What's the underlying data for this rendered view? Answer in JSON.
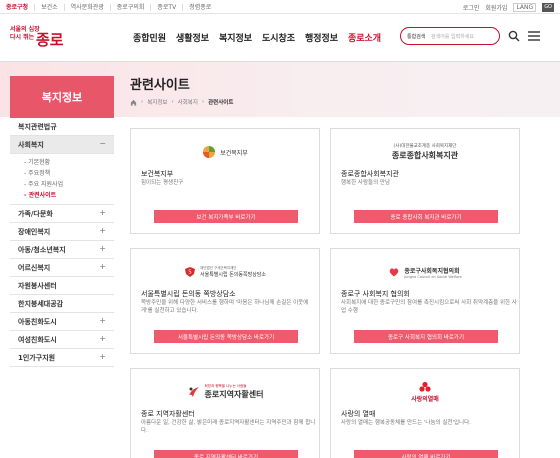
{
  "util_bar": {
    "links": [
      "종로구청",
      "보건소",
      "역사문화관광",
      "종로구의회",
      "종로TV",
      "청렴종로"
    ],
    "login": "로그인",
    "join": "회원가입",
    "lang": "LANG",
    "go": "GO"
  },
  "header": {
    "logo_small_1": "서울의 심장",
    "logo_small_2": "다시 뛰는",
    "logo_big": "종로",
    "gnb": [
      "종합민원",
      "생활정보",
      "복지정보",
      "도시창조",
      "행정정보",
      "종로소개"
    ],
    "gnb_active": "종로소개",
    "search": {
      "select": "통합검색",
      "placeholder": "검색어를 입력하세요"
    }
  },
  "sidebar": {
    "head": "복지정보",
    "items": [
      {
        "label": "복지관련법규",
        "toggle": ""
      },
      {
        "label": "사회복지",
        "toggle": "−"
      },
      {
        "label": "가족/다문화",
        "toggle": "+"
      },
      {
        "label": "장애인복지",
        "toggle": "+"
      },
      {
        "label": "아동/청소년복지",
        "toggle": "+"
      },
      {
        "label": "어르신복지",
        "toggle": "+"
      },
      {
        "label": "자원봉사센터",
        "toggle": ""
      },
      {
        "label": "한지붕세대공감",
        "toggle": ""
      },
      {
        "label": "아동친화도시",
        "toggle": "+"
      },
      {
        "label": "여성친화도시",
        "toggle": "+"
      },
      {
        "label": "1인가구지원",
        "toggle": "+"
      }
    ],
    "sub": [
      "- 기본현황",
      "- 주요정책",
      "- 주요 지원사업",
      "- 관련사이트"
    ]
  },
  "content": {
    "title": "관련사이트",
    "breadcrumb": [
      "복지정보",
      "사회복지",
      "관련사이트"
    ],
    "cards": [
      {
        "logo_text": "보건복지부",
        "title": "보건복지부",
        "desc": "힘이되는 평생친구",
        "button": "보건 복지가족부 바로가기"
      },
      {
        "logo_text": "종로종합사회복지관",
        "logo_sub": "(사)대한불교조계종 사회복지재단",
        "title": "종로종합사회복지관",
        "desc": "행복한 사람들의 만남",
        "button": "종로 종합사회 복지관 바로가기"
      },
      {
        "logo_text": "서울특별시립 돈의동쪽방상담소",
        "logo_sub": "재단법인 구세군복지재단",
        "title": "서울특별시립 돈의동 쪽방상담소",
        "desc": "쪽방주민을 위해 다양한 서비스를 행하며 '마음은 하나님께 손길은 이웃에게'를 실천하고 있습니다.",
        "button": "서울특별시립 돈의동 쪽방상담소 바로가기"
      },
      {
        "logo_text": "종로구사회복지협의회",
        "logo_sub": "Jongno Council on Social Welfare",
        "title": "종로구 사회복지 협의회",
        "desc": "사회복지에 대한 종로구민의 참여를 촉진시킴으로써 사회 취약계층을 위한 사업 수행",
        "button": "종로구 사회복지 협의회 바로가기"
      },
      {
        "logo_text": "종로지역자활센터",
        "logo_sub": "희망과 행복을 나누는 사람들",
        "title": "종로 지역자활센터",
        "desc": "아름다운 일, 건강한 삶, 밝은미래 종로지역자활센터는 지역주민과 함께 합니다.",
        "button": "종로 지역자활센터 바로가기"
      },
      {
        "logo_text": "사랑의열매",
        "title": "사랑의 열매",
        "desc": "사랑의 열매는 행복공동체를 만드는 '나눔의 실천'입니다.",
        "button": "사랑의 열매 바로가기"
      }
    ]
  },
  "colors": {
    "accent": "#c8102e",
    "button": "#ef5a6c",
    "sidebar_head": "#e8566a"
  }
}
